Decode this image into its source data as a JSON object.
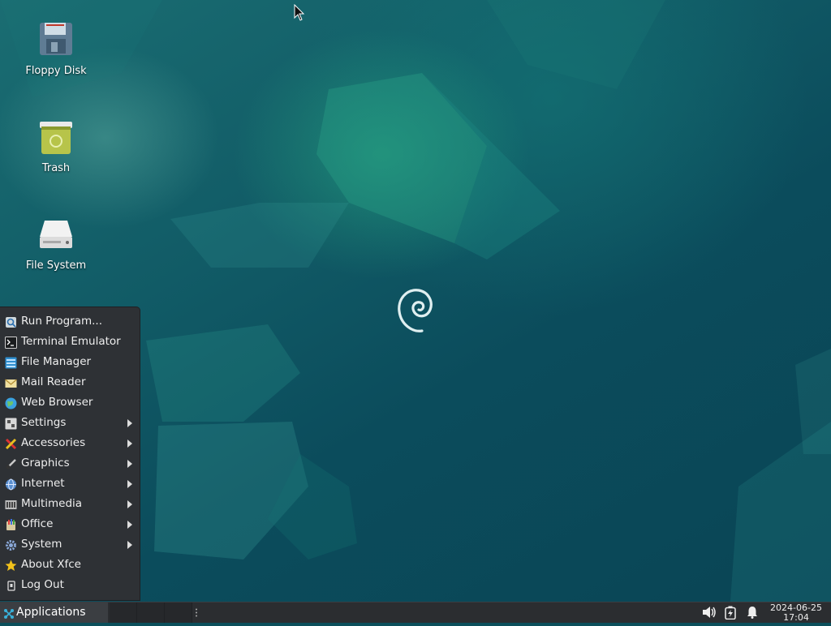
{
  "desktop": {
    "icons": [
      {
        "label": "Floppy Disk",
        "icon": "floppy-disk-icon"
      },
      {
        "label": "Trash",
        "icon": "trash-icon"
      },
      {
        "label": "File System",
        "icon": "hard-drive-icon"
      }
    ],
    "logo": "debian-swirl-logo"
  },
  "app_menu": {
    "items": [
      {
        "label": "Run Program...",
        "icon": "run-icon",
        "submenu": false
      },
      {
        "label": "Terminal Emulator",
        "icon": "terminal-icon",
        "submenu": false
      },
      {
        "label": "File Manager",
        "icon": "file-manager-icon",
        "submenu": false
      },
      {
        "label": "Mail Reader",
        "icon": "mail-icon",
        "submenu": false
      },
      {
        "label": "Web Browser",
        "icon": "globe-icon",
        "submenu": false
      },
      {
        "label": "Settings",
        "icon": "settings-icon",
        "submenu": true
      },
      {
        "label": "Accessories",
        "icon": "accessories-icon",
        "submenu": true
      },
      {
        "label": "Graphics",
        "icon": "brush-icon",
        "submenu": true
      },
      {
        "label": "Internet",
        "icon": "internet-icon",
        "submenu": true
      },
      {
        "label": "Multimedia",
        "icon": "multimedia-icon",
        "submenu": true
      },
      {
        "label": "Office",
        "icon": "office-icon",
        "submenu": true
      },
      {
        "label": "System",
        "icon": "gear-icon",
        "submenu": true
      },
      {
        "label": "About Xfce",
        "icon": "star-icon",
        "submenu": false
      },
      {
        "label": "Log Out",
        "icon": "logout-icon",
        "submenu": false
      }
    ]
  },
  "panel": {
    "applications_label": "Applications",
    "clock_date": "2024-06-25",
    "clock_time": "17:04",
    "tray": [
      "volume-icon",
      "battery-icon",
      "notification-bell-icon"
    ]
  },
  "colors": {
    "accent": "#2aa0a8",
    "panel_bg": "#2b2d30",
    "menu_bg": "#2e3135"
  }
}
